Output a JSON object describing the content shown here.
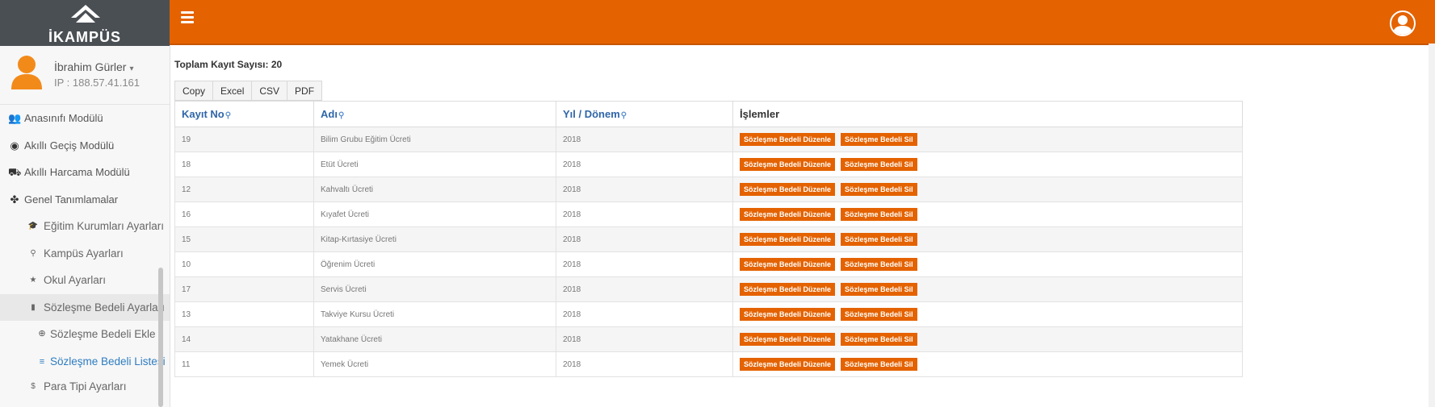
{
  "brand": {
    "logo_text": "İKAMPÜS"
  },
  "user": {
    "name": "İbrahim Gürler",
    "ip": "IP : 188.57.41.161"
  },
  "menu": [
    {
      "label": "Anasınıfı Modülü",
      "icon": "users-icon"
    },
    {
      "label": "Akıllı Geçiş Modülü",
      "icon": "compass-icon"
    },
    {
      "label": "Akıllı Harcama Modülü",
      "icon": "basket-icon"
    },
    {
      "label": "Genel Tanımlamalar",
      "icon": "puzzle-icon"
    },
    {
      "label": "Eğitim Kurumları Ayarları",
      "icon": "graduation-cap-icon"
    },
    {
      "label": "Kampüs Ayarları",
      "icon": "map-marker-icon"
    },
    {
      "label": "Okul Ayarları",
      "icon": "star-icon"
    },
    {
      "label": "Sözleşme Bedeli Ayarları",
      "icon": "bookmark-icon"
    },
    {
      "label": "Sözleşme Bedeli Ekle",
      "icon": "plus-circle-icon"
    },
    {
      "label": "Sözleşme Bedeli Listesi",
      "icon": "list-icon"
    },
    {
      "label": "Para Tipi Ayarları",
      "icon": "dollar-icon"
    }
  ],
  "total_label": "Toplam Kayıt Sayısı: 20",
  "export_buttons": [
    "Copy",
    "Excel",
    "CSV",
    "PDF"
  ],
  "table": {
    "headers": [
      "Kayıt No",
      "Adı",
      "Yıl / Dönem",
      "İşlemler"
    ],
    "edit_label": "Sözleşme Bedeli Düzenle",
    "delete_label": "Sözleşme Bedeli Sil",
    "rows": [
      [
        "19",
        "Bilim Grubu Eğitim Ücreti",
        "2018"
      ],
      [
        "18",
        "Etüt Ücreti",
        "2018"
      ],
      [
        "12",
        "Kahvaltı Ücreti",
        "2018"
      ],
      [
        "16",
        "Kıyafet Ücreti",
        "2018"
      ],
      [
        "15",
        "Kitap-Kırtasiye Ücreti",
        "2018"
      ],
      [
        "10",
        "Öğrenim Ücreti",
        "2018"
      ],
      [
        "17",
        "Servis Ücreti",
        "2018"
      ],
      [
        "13",
        "Takviye Kursu Ücreti",
        "2018"
      ],
      [
        "14",
        "Yatakhane Ücreti",
        "2018"
      ],
      [
        "11",
        "Yemek Ücreti",
        "2018"
      ]
    ]
  },
  "colors": {
    "accent": "#e46200",
    "sidebar_bg": "#f7f7f7",
    "logo_bg": "#4a4f54",
    "link": "#2f66a8"
  }
}
